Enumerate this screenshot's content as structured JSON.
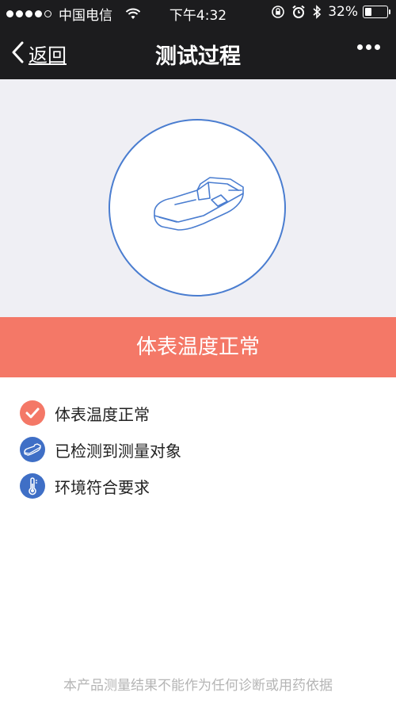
{
  "status_bar": {
    "carrier": "中国电信",
    "time": "下午4:32",
    "battery_text": "32%",
    "battery_level": 0.32
  },
  "nav": {
    "back_label": "返回",
    "title": "测试过程"
  },
  "banner": {
    "text": "体表温度正常",
    "color": "#f47867"
  },
  "checks": [
    {
      "label": "体表温度正常",
      "icon": "checkmark-icon"
    },
    {
      "label": "已检测到测量对象",
      "icon": "device-icon"
    },
    {
      "label": "环境符合要求",
      "icon": "thermometer-icon"
    }
  ],
  "disclaimer": "本产品测量结果不能作为任何诊断或用药依据",
  "colors": {
    "accent_orange": "#f47867",
    "accent_blue": "#3f6fc6",
    "nav_bg": "#1c1c1e",
    "hero_bg": "#efeff4"
  }
}
